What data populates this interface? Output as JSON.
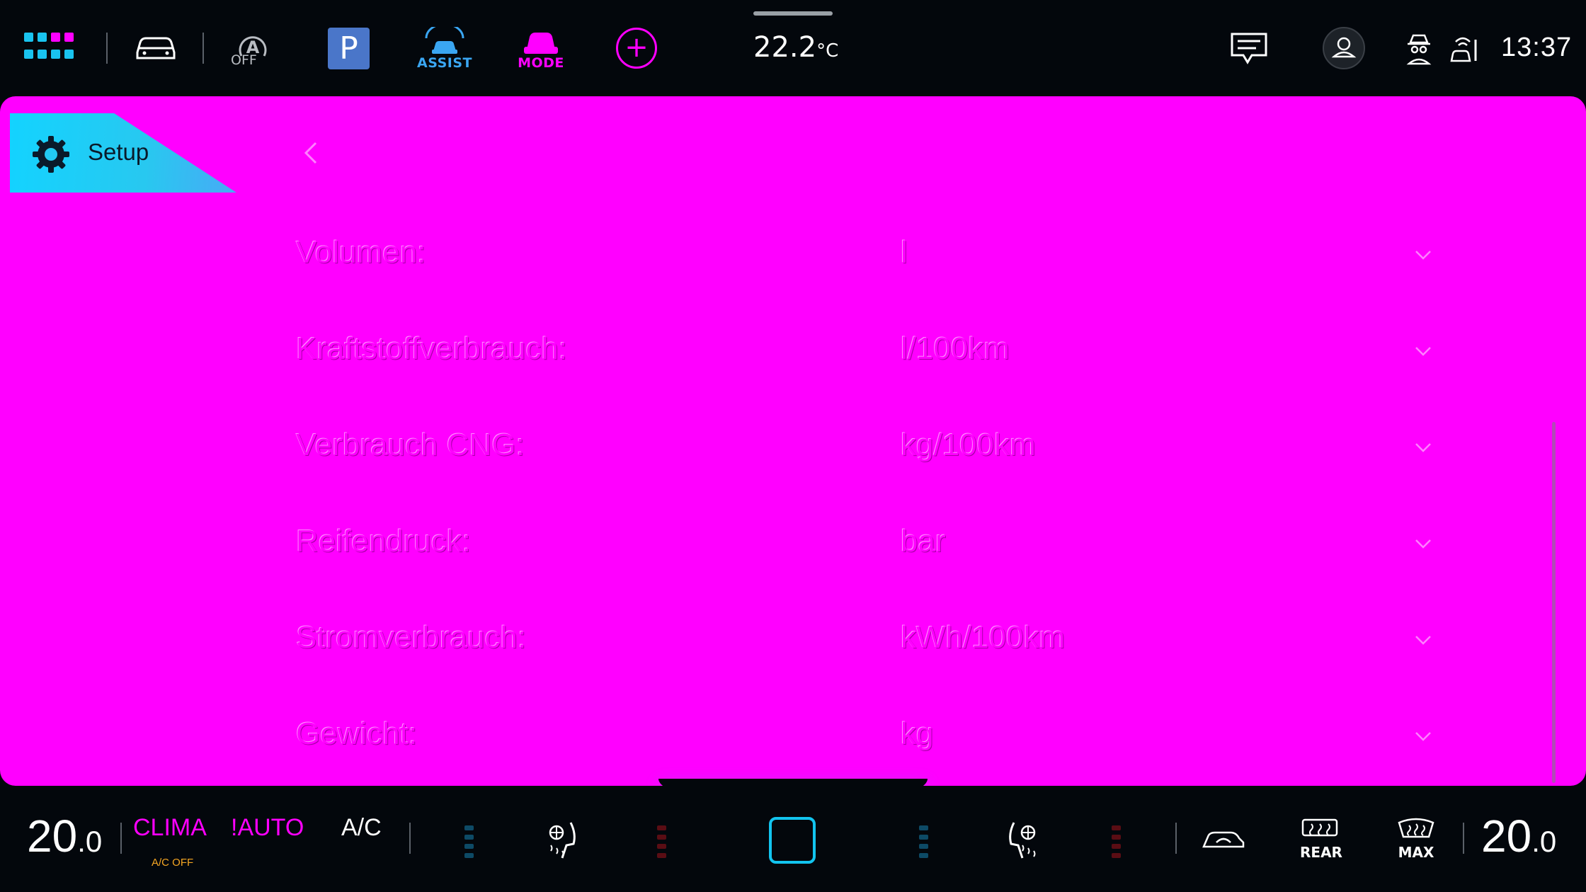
{
  "topbar": {
    "apps_icon": "apps-grid-icon",
    "car_icon": "car-icon",
    "auto_hold_label": "OFF",
    "parking_label": "P",
    "assist_label": "ASSIST",
    "mode_label": "MODE",
    "add_label": "+",
    "outside_temp": "22.2",
    "outside_temp_unit": "°C",
    "message_icon": "message-icon",
    "profile_icon": "profile-icon",
    "privacy_icon": "incognito-icon",
    "connectivity_icon": "car-connect-icon",
    "clock": "13:37"
  },
  "panel": {
    "tab_label": "Setup",
    "rows": [
      {
        "label": "Volumen:",
        "value": "l"
      },
      {
        "label": "Kraftstoffverbrauch:",
        "value": "l/100km"
      },
      {
        "label": "Verbrauch CNG:",
        "value": "kg/100km"
      },
      {
        "label": "Reifendruck:",
        "value": "bar"
      },
      {
        "label": "Stromverbrauch:",
        "value": "kWh/100km"
      },
      {
        "label": "Gewicht:",
        "value": "kg"
      }
    ]
  },
  "bottombar": {
    "left_temp_int": "20",
    "left_temp_dec": ".0",
    "clima_label": "CLIMA",
    "ac_off_label": "A/C OFF",
    "auto_label": "!AUTO",
    "ac_label": "A/C",
    "rear_label": "REAR",
    "max_label": "MAX",
    "right_temp_int": "20",
    "right_temp_dec": ".0"
  },
  "colors": {
    "accent": "#ff00ff",
    "cyan": "#12c4ef",
    "assist_blue": "#3aa6f2",
    "ac_off_orange": "#f5a623"
  }
}
